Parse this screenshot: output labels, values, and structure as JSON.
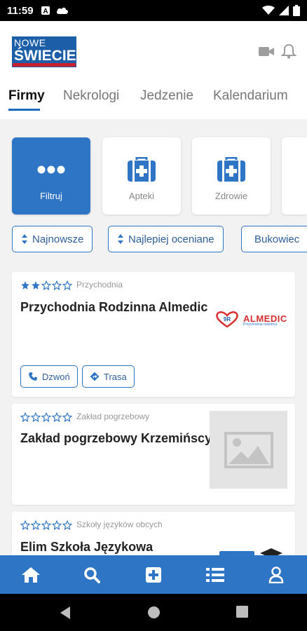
{
  "status_bar": {
    "time": "11:59"
  },
  "logo": {
    "line1": "NOWE",
    "line2": "ŚWIECIE"
  },
  "tabs": [
    {
      "label": "Firmy",
      "active": true
    },
    {
      "label": "Nekrologi",
      "active": false
    },
    {
      "label": "Jedzenie",
      "active": false
    },
    {
      "label": "Kalendarium",
      "active": false
    }
  ],
  "categories": [
    {
      "label": "Filtruj",
      "icon": "more-dots-icon",
      "active": true
    },
    {
      "label": "Apteki",
      "icon": "medical-kit-icon",
      "active": false
    },
    {
      "label": "Zdrowie",
      "icon": "medical-kit-icon",
      "active": false
    }
  ],
  "filters": [
    {
      "label": "Najnowsze",
      "icon": "sort-icon"
    },
    {
      "label": "Najlepiej oceniane",
      "icon": "sort-icon"
    },
    {
      "label": "Bukowiec",
      "icon": "location-pin-icon"
    }
  ],
  "listings": [
    {
      "category": "Przychodnia",
      "title": "Przychodnia Rodzinna Almedic",
      "rating": 2,
      "logo_text": "ALMEDIC",
      "logo_sub": "Przychodnia rodzinna",
      "call_label": "Dzwoń",
      "route_label": "Trasa"
    },
    {
      "category": "Zakład pogrzebowy",
      "title": "Zakład pogrzebowy Krzemińscy",
      "rating": 0
    },
    {
      "category": "Szkoły języków obcych",
      "title": "Elim Szkoła Językowa",
      "rating": 0
    }
  ],
  "colors": {
    "accent": "#2f75c6",
    "star": "#2f75c6",
    "brand_red": "#c8202f"
  }
}
